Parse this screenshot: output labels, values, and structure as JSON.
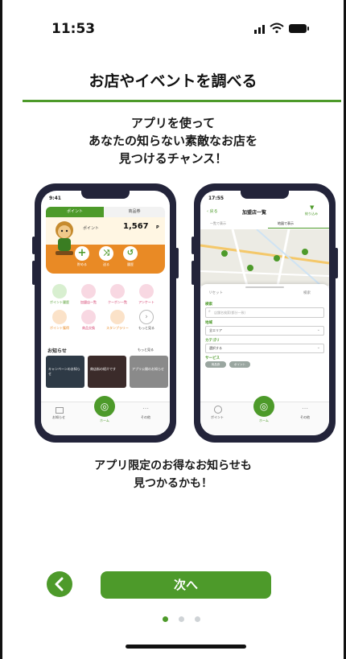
{
  "status_bar": {
    "time": "11:53"
  },
  "header": {
    "title": "お店やイベントを調べる"
  },
  "intro": {
    "line1": "アプリを使って",
    "line2": "あなたの知らない素敵なお店を",
    "line3": "見つけるチャンス！"
  },
  "phone_left": {
    "time": "9:41",
    "tabs": [
      "ポイント",
      "商品券"
    ],
    "points_label": "ポイント",
    "points_value": "1,567",
    "points_unit": "P",
    "actions": [
      "貯める",
      "送る",
      "履歴"
    ],
    "menu": [
      "ポイント履歴",
      "加盟店一覧",
      "クーポン一覧",
      "アンケート",
      "ポイント獲得",
      "商品交換",
      "スタンプラリー",
      "もっと見る"
    ],
    "news_title": "お知らせ",
    "news_more": "もっと見る",
    "news_cards": [
      "キャンペーンのお知らせ",
      "商店街の紹介です",
      "アプリ公開のお知らせ"
    ],
    "nav": [
      "お知らせ",
      "ホーム",
      "その他"
    ]
  },
  "phone_right": {
    "time": "17:55",
    "back": "戻る",
    "title": "加盟店一覧",
    "filter_label": "絞り込み",
    "tabs": [
      "一覧で表示",
      "地図で表示"
    ],
    "sheet": {
      "reset": "リセット",
      "search_btn": "検索",
      "keyword_label": "検索",
      "keyword_placeholder": "店舗名検索(都分一致)",
      "area_label": "地域",
      "area_value": "全エリア",
      "category_label": "カテゴリ",
      "category_value": "選択する",
      "service_label": "サービス",
      "chips": [
        "商品券",
        "ポイント"
      ]
    },
    "nav": [
      "ポイント",
      "ホーム",
      "その他"
    ]
  },
  "bottom_text": {
    "line1": "アプリ限定のお得なお知らせも",
    "line2": "見つかるかも！"
  },
  "next_button": {
    "label": "次へ"
  },
  "pagination": {
    "total": 3,
    "active": 1
  },
  "colors": {
    "accent": "#4d9a2a",
    "orange": "#e98a25",
    "phone": "#23243a"
  }
}
